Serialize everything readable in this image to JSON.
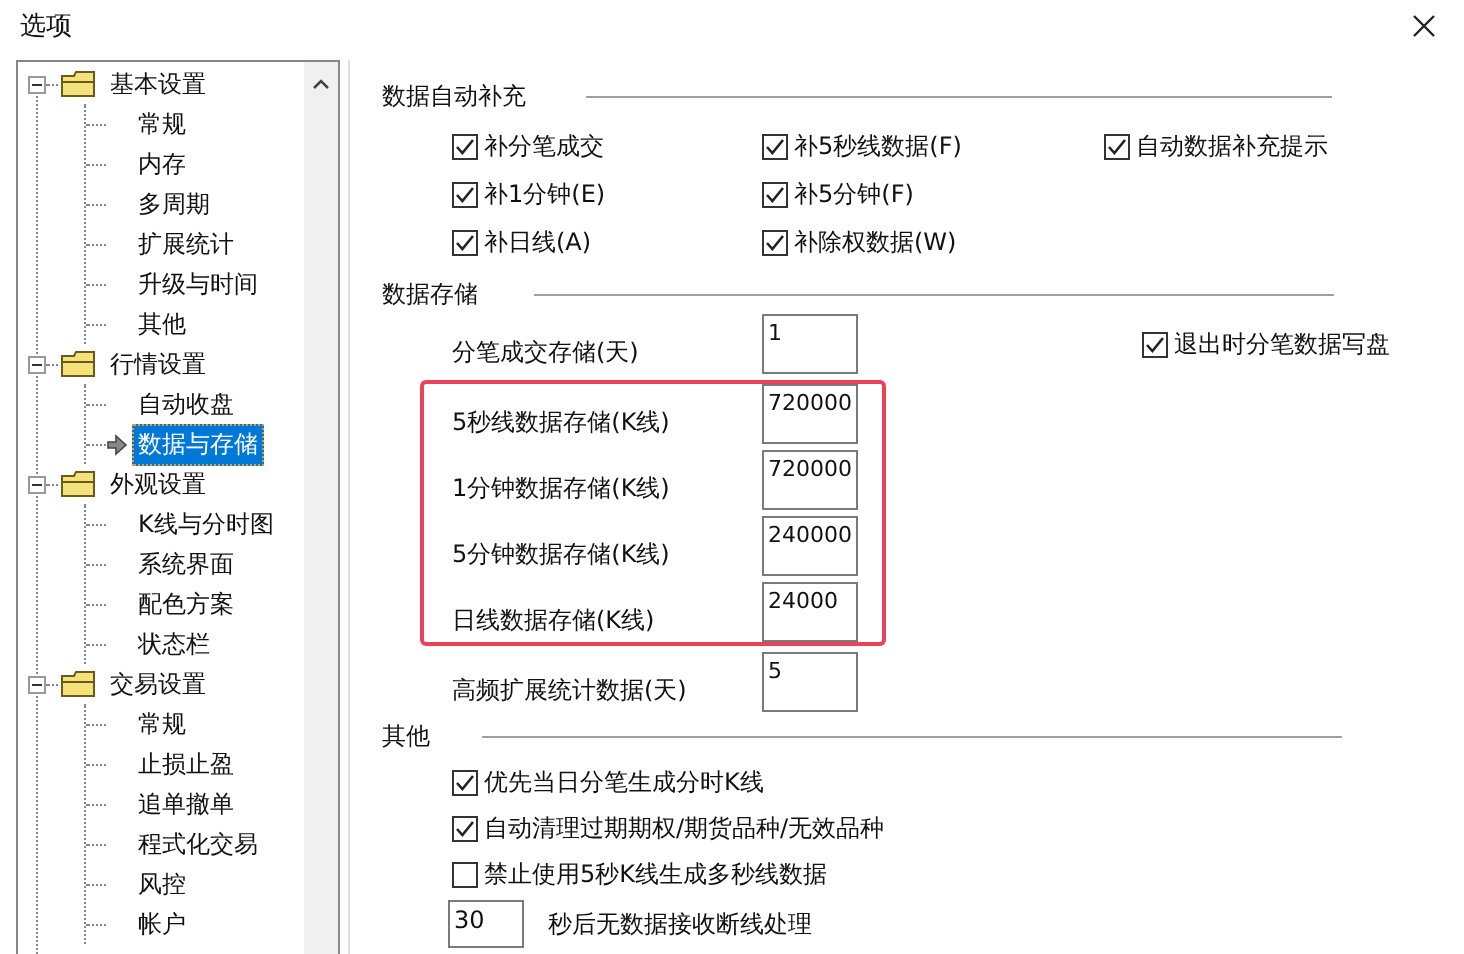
{
  "window": {
    "title": "选项"
  },
  "tree": [
    {
      "label": "基本设置",
      "expanded": true,
      "children": [
        {
          "label": "常规",
          "selected": false
        },
        {
          "label": "内存",
          "selected": false
        },
        {
          "label": "多周期",
          "selected": false
        },
        {
          "label": "扩展统计",
          "selected": false
        },
        {
          "label": "升级与时间",
          "selected": false
        },
        {
          "label": "其他",
          "selected": false
        }
      ]
    },
    {
      "label": "行情设置",
      "expanded": true,
      "children": [
        {
          "label": "自动收盘",
          "selected": false
        },
        {
          "label": "数据与存储",
          "selected": true
        }
      ]
    },
    {
      "label": "外观设置",
      "expanded": true,
      "children": [
        {
          "label": "K线与分时图",
          "selected": false
        },
        {
          "label": "系统界面",
          "selected": false
        },
        {
          "label": "配色方案",
          "selected": false
        },
        {
          "label": "状态栏",
          "selected": false
        }
      ]
    },
    {
      "label": "交易设置",
      "expanded": true,
      "children": [
        {
          "label": "常规",
          "selected": false
        },
        {
          "label": "止损止盈",
          "selected": false
        },
        {
          "label": "追单撤单",
          "selected": false
        },
        {
          "label": "程式化交易",
          "selected": false
        },
        {
          "label": "风控",
          "selected": false
        },
        {
          "label": "帐户",
          "selected": false
        }
      ]
    }
  ],
  "auto_fill": {
    "title": "数据自动补充",
    "options": [
      {
        "label": "补分笔成交",
        "checked": true
      },
      {
        "label": "补5秒线数据(F)",
        "checked": true
      },
      {
        "label": "自动数据补充提示",
        "checked": true
      },
      {
        "label": "补1分钟(E)",
        "checked": true
      },
      {
        "label": "补5分钟(F)",
        "checked": true
      },
      {
        "label": "补日线(A)",
        "checked": true
      },
      {
        "label": "补除权数据(W)",
        "checked": true
      }
    ]
  },
  "storage": {
    "title": "数据存储",
    "groups": [
      {
        "framed": false,
        "rows": [
          {
            "label": "分笔成交存储(天)",
            "value": "1"
          }
        ]
      },
      {
        "framed": true,
        "rows": [
          {
            "label": "5秒线数据存储(K线)",
            "value": "720000"
          },
          {
            "label": "1分钟数据存储(K线)",
            "value": "720000"
          },
          {
            "label": "5分钟数据存储(K线)",
            "value": "240000"
          },
          {
            "label": "日线数据存储(K线)",
            "value": "24000"
          }
        ]
      },
      {
        "framed": false,
        "rows": [
          {
            "label": "高频扩展统计数据(天)",
            "value": "5"
          }
        ]
      }
    ],
    "option": {
      "label": "退出时分笔数据写盘",
      "checked": true
    }
  },
  "other": {
    "title": "其他",
    "items": [
      {
        "kind": "checkbox",
        "label": "优先当日分笔生成分时K线",
        "checked": true
      },
      {
        "kind": "checkbox",
        "label": "自动清理过期期权/期货品种/无效品种",
        "checked": true
      },
      {
        "kind": "checkbox",
        "label": "禁止使用5秒K线生成多秒线数据",
        "checked": false
      },
      {
        "kind": "number",
        "value": "30",
        "label": "秒后无数据接收断线处理"
      }
    ]
  }
}
